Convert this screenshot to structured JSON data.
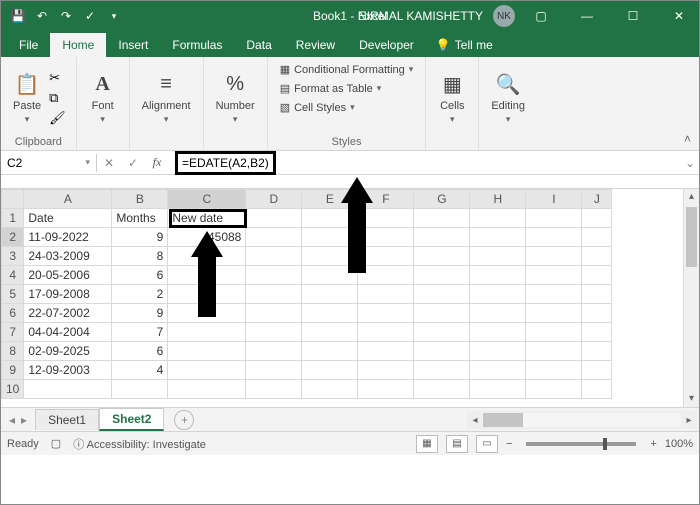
{
  "titlebar": {
    "workbook": "Book1",
    "app": "Excel",
    "user": "NIRMAL KAMISHETTY",
    "initials": "NK"
  },
  "tabs": {
    "file": "File",
    "home": "Home",
    "insert": "Insert",
    "formulas": "Formulas",
    "data": "Data",
    "review": "Review",
    "developer": "Developer",
    "tellme": "Tell me"
  },
  "ribbon": {
    "paste": "Paste",
    "clipboard": "Clipboard",
    "font": "Font",
    "alignment": "Alignment",
    "number": "Number",
    "cond": "Conditional Formatting",
    "table": "Format as Table",
    "styles": "Cell Styles",
    "styles_title": "Styles",
    "cells": "Cells",
    "editing": "Editing"
  },
  "fx": {
    "cellref": "C2",
    "formula": "=EDATE(A2,B2)"
  },
  "columns": [
    "A",
    "B",
    "C",
    "D",
    "E",
    "F",
    "G",
    "H",
    "I",
    "J"
  ],
  "headers": {
    "A": "Date",
    "B": "Months",
    "C": "New date"
  },
  "rows": [
    {
      "n": 1
    },
    {
      "n": 2,
      "A": "11-09-2022",
      "B": 9,
      "C": 45088
    },
    {
      "n": 3,
      "A": "24-03-2009",
      "B": 8
    },
    {
      "n": 4,
      "A": "20-05-2006",
      "B": 6
    },
    {
      "n": 5,
      "A": "17-09-2008",
      "B": 2
    },
    {
      "n": 6,
      "A": "22-07-2002",
      "B": 9
    },
    {
      "n": 7,
      "A": "04-04-2004",
      "B": 7
    },
    {
      "n": 8,
      "A": "02-09-2025",
      "B": 6
    },
    {
      "n": 9,
      "A": "12-09-2003",
      "B": 4
    },
    {
      "n": 10
    }
  ],
  "sheets": {
    "s1": "Sheet1",
    "s2": "Sheet2"
  },
  "status": {
    "ready": "Ready",
    "accessibility": "Accessibility: Investigate",
    "zoom": "100%"
  }
}
